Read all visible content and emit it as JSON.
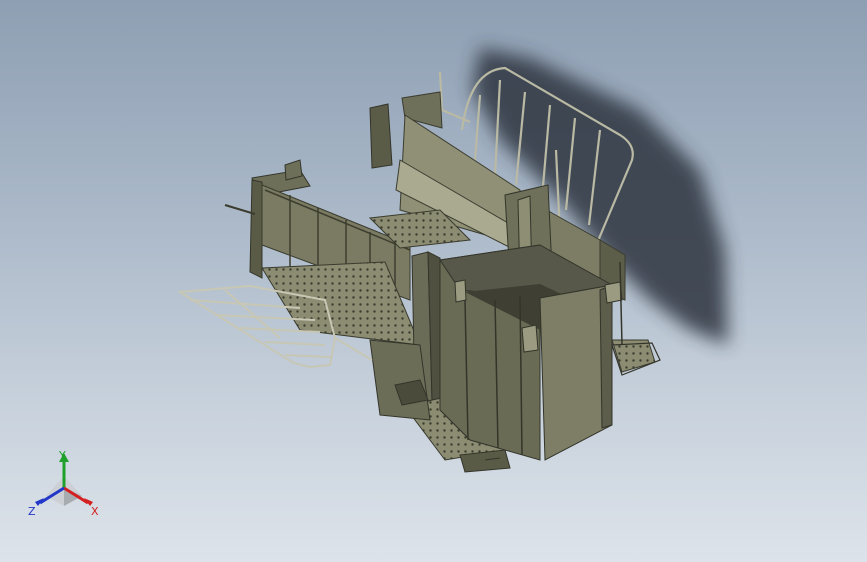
{
  "viewport": {
    "background_top": "#8e9fb3",
    "background_bottom": "#dde3ea",
    "model_color": "#7c7d64",
    "model_dark": "#4e4f3d",
    "model_light": "#a3a48a",
    "shadow_color": "#2e3640"
  },
  "triad": {
    "x_label": "X",
    "y_label": "Y",
    "z_label": "Z",
    "x_color": "#d42020",
    "y_color": "#1fa02a",
    "z_color": "#2236c8"
  }
}
